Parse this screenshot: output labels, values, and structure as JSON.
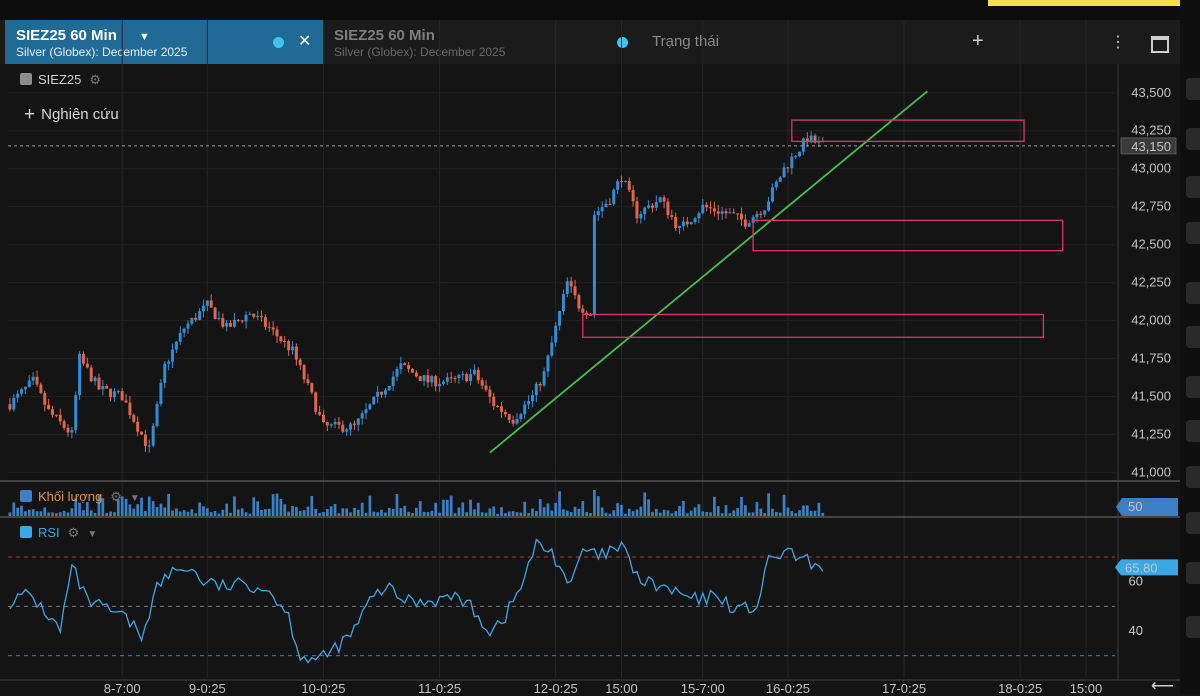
{
  "header": {
    "active_tab": {
      "title": "SIEZ25 60 Min",
      "subtitle": "Silver (Globex): December 2025"
    },
    "second_tab": {
      "title": "SIEZ25 60 Min",
      "subtitle": "Silver (Globex): December 2025"
    },
    "status_label": "Trạng thái",
    "add_label": "+",
    "menu_label": "⋮",
    "close_label": "✕"
  },
  "legend": {
    "symbol": "SIEZ25",
    "study_label": "Nghiên cứu",
    "volume_label": "Khối lượng",
    "rsi_label": "RSI"
  },
  "colors": {
    "up": "#2f8fd8",
    "down": "#e5664a",
    "trend": "#43c24a",
    "zone": "#e0356a",
    "accent": "#1f6b96"
  },
  "chart_data": [
    {
      "type": "candlestick",
      "symbol": "SIEZ25",
      "interval": "60 Min",
      "last_price": "43,150",
      "ylim": [
        40950,
        43650
      ],
      "y_ticks": [
        41000,
        41250,
        41500,
        41750,
        42000,
        42250,
        42500,
        42750,
        43000,
        43250,
        43500
      ],
      "y_tick_labels": [
        "41,000",
        "41,250",
        "41,500",
        "41,750",
        "42,000",
        "42,250",
        "42,500",
        "42,750",
        "43,000",
        "43,250",
        "43,500"
      ],
      "x_ticks": [
        {
          "label": "8-7:00",
          "i": 29
        },
        {
          "label": "9-0:25",
          "i": 51
        },
        {
          "label": "10-0:25",
          "i": 81
        },
        {
          "label": "11-0:25",
          "i": 111
        },
        {
          "label": "12-0:25",
          "i": 141
        },
        {
          "label": "15:00",
          "i": 158
        },
        {
          "label": "15-7:00",
          "i": 179
        },
        {
          "label": "16-0:25",
          "i": 201
        },
        {
          "label": "17-0:25",
          "i": 231
        },
        {
          "label": "18-0:25",
          "i": 261
        },
        {
          "label": "15:00",
          "i": 278
        }
      ],
      "n_slots": 286,
      "anchors": [
        [
          0,
          41450
        ],
        [
          6,
          41600
        ],
        [
          10,
          41400
        ],
        [
          16,
          41250
        ],
        [
          18,
          41750
        ],
        [
          23,
          41550
        ],
        [
          29,
          41500
        ],
        [
          34,
          41250
        ],
        [
          36,
          41150
        ],
        [
          40,
          41700
        ],
        [
          45,
          41950
        ],
        [
          51,
          42100
        ],
        [
          56,
          41950
        ],
        [
          62,
          42050
        ],
        [
          67,
          41950
        ],
        [
          73,
          41800
        ],
        [
          78,
          41500
        ],
        [
          81,
          41300
        ],
        [
          89,
          41300
        ],
        [
          95,
          41500
        ],
        [
          101,
          41700
        ],
        [
          108,
          41600
        ],
        [
          114,
          41600
        ],
        [
          120,
          41650
        ],
        [
          125,
          41450
        ],
        [
          130,
          41350
        ],
        [
          135,
          41500
        ],
        [
          138,
          41650
        ],
        [
          141,
          41950
        ],
        [
          144,
          42250
        ],
        [
          147,
          42100
        ],
        [
          150,
          42050
        ],
        [
          151,
          42700
        ],
        [
          155,
          42800
        ],
        [
          158,
          42950
        ],
        [
          162,
          42700
        ],
        [
          168,
          42800
        ],
        [
          173,
          42600
        ],
        [
          179,
          42750
        ],
        [
          186,
          42700
        ],
        [
          190,
          42650
        ],
        [
          195,
          42750
        ],
        [
          200,
          43000
        ],
        [
          206,
          43200
        ],
        [
          210,
          43150
        ]
      ],
      "volume": {
        "last": "50"
      },
      "trendline": [
        {
          "i": 124,
          "y": 41130
        },
        {
          "i": 237,
          "y": 43510
        }
      ],
      "zones": [
        {
          "i1": 202,
          "i2": 262,
          "y_top": 43320,
          "y_bottom": 43180
        },
        {
          "i1": 192,
          "i2": 272,
          "y_top": 42660,
          "y_bottom": 42460
        },
        {
          "i1": 148,
          "i2": 267,
          "y_top": 42040,
          "y_bottom": 41890
        }
      ]
    },
    {
      "type": "line",
      "name": "RSI",
      "last": "65.80",
      "ylim": [
        25,
        85
      ],
      "y_ticks": [
        40,
        60
      ],
      "levels": [
        30,
        50,
        70
      ],
      "anchors": [
        [
          0,
          52
        ],
        [
          5,
          55
        ],
        [
          9,
          48
        ],
        [
          13,
          40
        ],
        [
          16,
          66
        ],
        [
          20,
          52
        ],
        [
          26,
          48
        ],
        [
          30,
          45
        ],
        [
          34,
          38
        ],
        [
          38,
          58
        ],
        [
          42,
          64
        ],
        [
          46,
          66
        ],
        [
          50,
          60
        ],
        [
          55,
          58
        ],
        [
          61,
          59
        ],
        [
          65,
          58
        ],
        [
          68,
          55
        ],
        [
          72,
          46
        ],
        [
          75,
          30
        ],
        [
          80,
          28
        ],
        [
          88,
          38
        ],
        [
          93,
          52
        ],
        [
          97,
          58
        ],
        [
          101,
          53
        ],
        [
          106,
          52
        ],
        [
          111,
          53
        ],
        [
          116,
          54
        ],
        [
          120,
          48
        ],
        [
          124,
          40
        ],
        [
          128,
          46
        ],
        [
          132,
          58
        ],
        [
          136,
          75
        ],
        [
          140,
          72
        ],
        [
          145,
          58
        ],
        [
          148,
          73
        ],
        [
          152,
          70
        ],
        [
          158,
          74
        ],
        [
          163,
          60
        ],
        [
          168,
          58
        ],
        [
          173,
          55
        ],
        [
          178,
          52
        ],
        [
          183,
          55
        ],
        [
          186,
          50
        ],
        [
          190,
          49
        ],
        [
          193,
          50
        ],
        [
          196,
          68
        ],
        [
          200,
          72
        ],
        [
          206,
          68
        ],
        [
          210,
          66
        ]
      ]
    }
  ]
}
